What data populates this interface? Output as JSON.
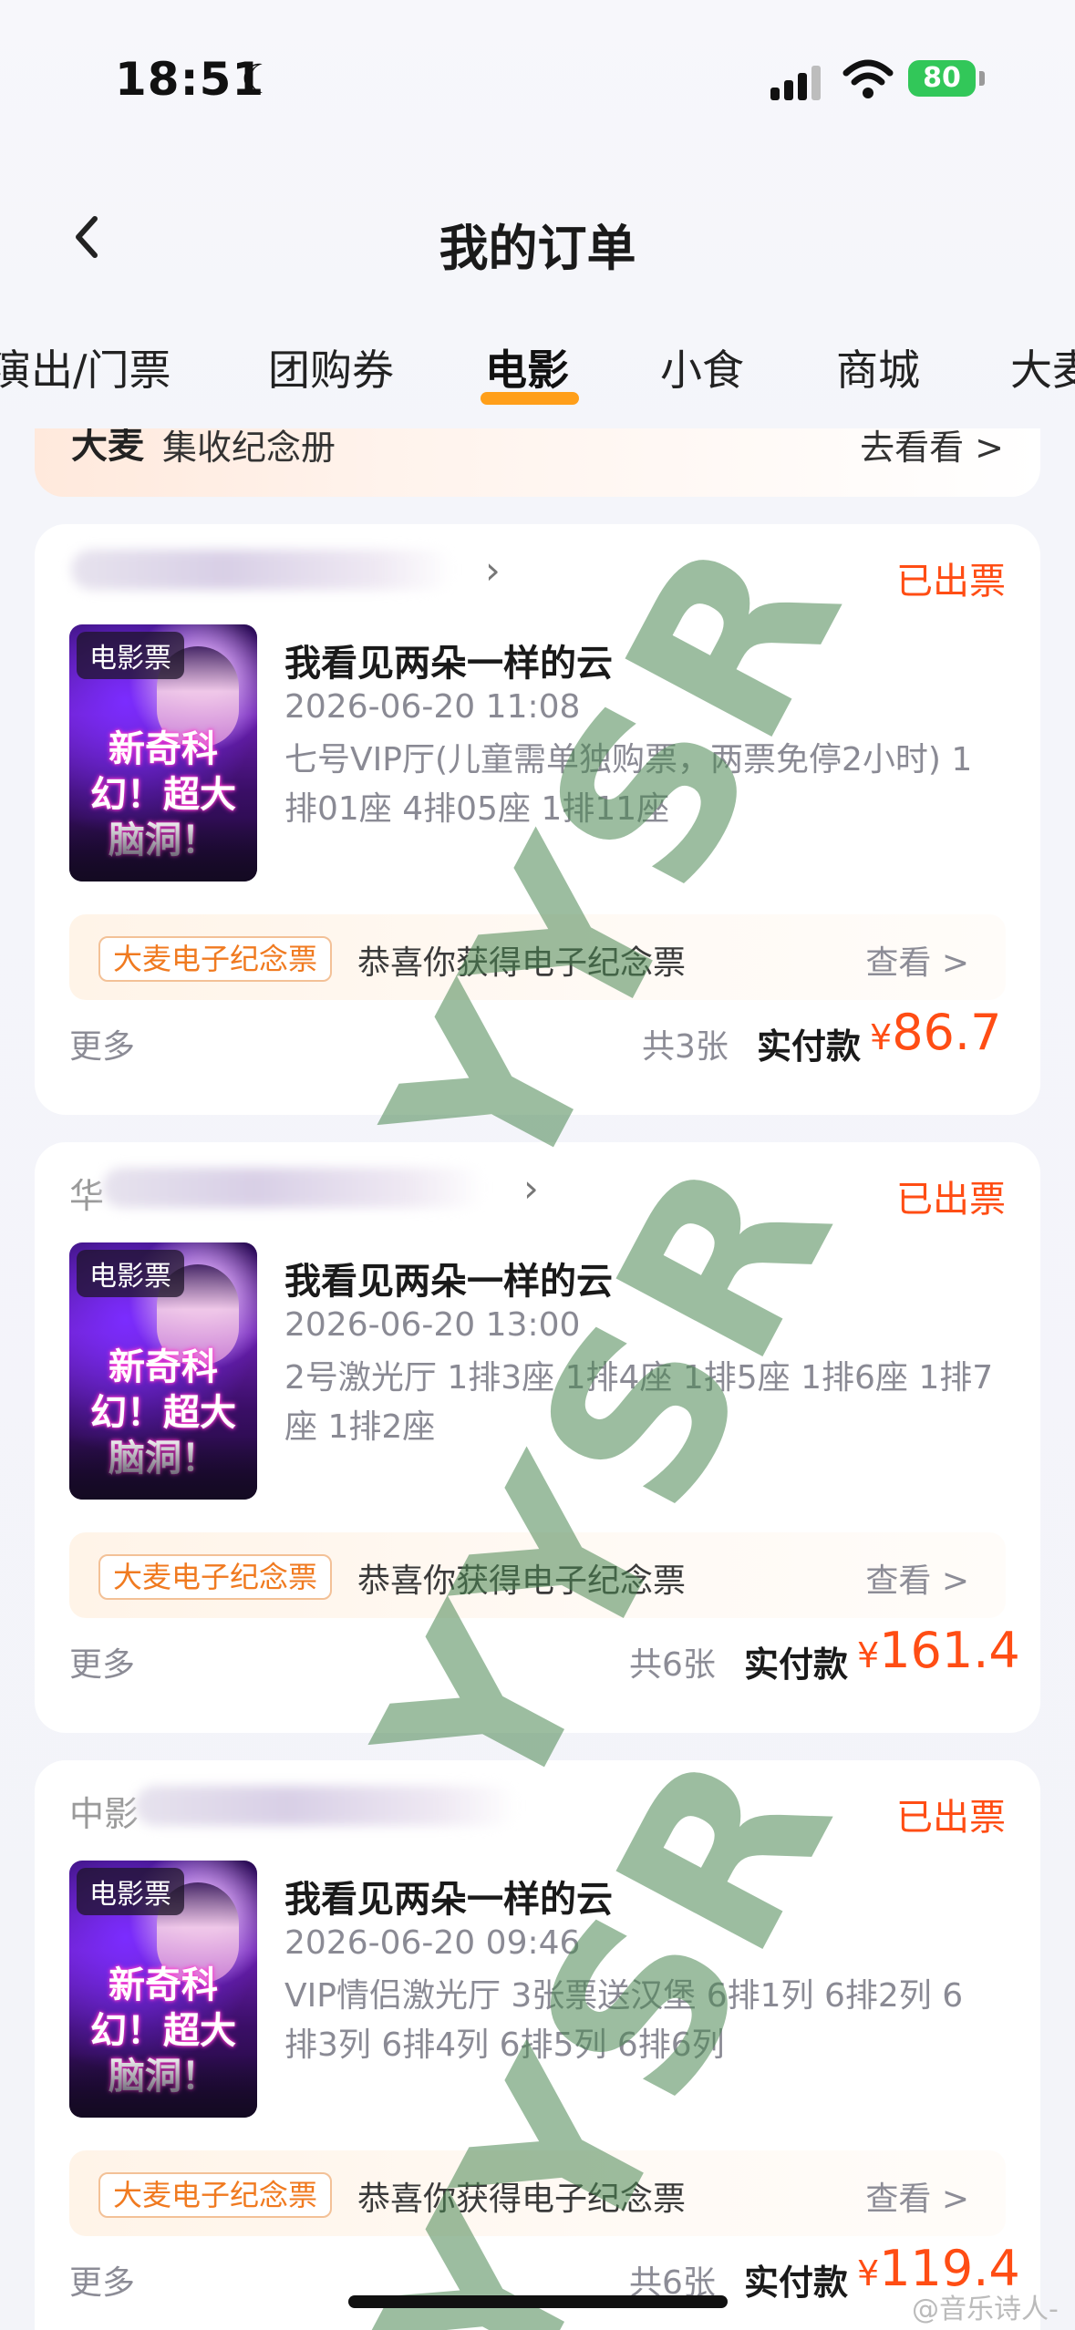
{
  "status_bar": {
    "time": "18:51",
    "battery": "80"
  },
  "nav": {
    "title": "我的订单"
  },
  "tabs": [
    {
      "label": "演出/门票"
    },
    {
      "label": "团购券"
    },
    {
      "label": "电影",
      "active": true
    },
    {
      "label": "小食"
    },
    {
      "label": "商城"
    },
    {
      "label": "大麦"
    }
  ],
  "banner": {
    "logo": "大麦",
    "text": "集收纪念册",
    "action": "去看看 >"
  },
  "orders": [
    {
      "shop_prefix": "",
      "status": "已出票",
      "poster_tag": "电影票",
      "poster_headline": "新奇科幻！超大脑洞！",
      "movie_title": "我看见两朵一样的云",
      "showtime": "2026-06-20 11:08",
      "hall_seats": "七号VIP厅(儿童需单独购票，两票免停2小时) 1排01座 4排05座 1排11座",
      "souvenir_badge": "大麦电子纪念票",
      "souvenir_text": "恭喜你获得电子纪念票",
      "souvenir_view": "查看 >",
      "more": "更多",
      "ticket_count": "共3张",
      "paid_label": "实付款",
      "currency": "¥",
      "price": "86.7"
    },
    {
      "shop_prefix": "华",
      "status": "已出票",
      "poster_tag": "电影票",
      "poster_headline": "新奇科幻！超大脑洞！",
      "movie_title": "我看见两朵一样的云",
      "showtime": "2026-06-20 13:00",
      "hall_seats": "2号激光厅 1排3座 1排4座 1排5座 1排6座 1排7座 1排2座",
      "souvenir_badge": "大麦电子纪念票",
      "souvenir_text": "恭喜你获得电子纪念票",
      "souvenir_view": "查看 >",
      "more": "更多",
      "ticket_count": "共6张",
      "paid_label": "实付款",
      "currency": "¥",
      "price": "161.4"
    },
    {
      "shop_prefix": "中影",
      "status": "已出票",
      "poster_tag": "电影票",
      "poster_headline": "新奇科幻！超大脑洞！",
      "movie_title": "我看见两朵一样的云",
      "showtime": "2026-06-20 09:46",
      "hall_seats": "VIP情侣激光厅 3张票送汉堡 6排1列 6排2列 6排3列 6排4列 6排5列 6排6列",
      "souvenir_badge": "大麦电子纪念票",
      "souvenir_text": "恭喜你获得电子纪念票",
      "souvenir_view": "查看 >",
      "more": "更多",
      "ticket_count": "共6张",
      "paid_label": "实付款",
      "currency": "¥",
      "price": "119.4"
    }
  ],
  "watermark": "YYSR",
  "credit": "@音乐诗人-"
}
